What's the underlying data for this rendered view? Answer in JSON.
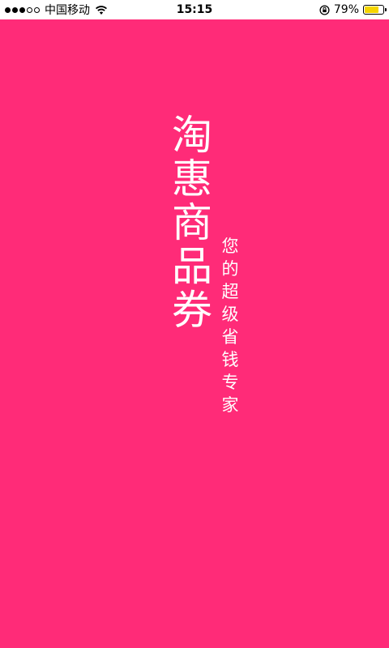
{
  "status_bar": {
    "carrier": "中国移动",
    "time": "15:15",
    "battery_text": "79%",
    "battery_level": 0.79,
    "battery_color": "#F5D400",
    "signal_strength": 3,
    "icons": [
      "signal-dots-icon",
      "wifi-icon",
      "rotation-lock-icon",
      "battery-icon"
    ]
  },
  "splash": {
    "background_color": "#FF2B78",
    "title_chars": [
      "淘",
      "惠",
      "商",
      "品",
      "券"
    ],
    "slogan_chars": [
      "您",
      "的",
      "超",
      "级",
      "省",
      "钱",
      "专",
      "家"
    ]
  }
}
